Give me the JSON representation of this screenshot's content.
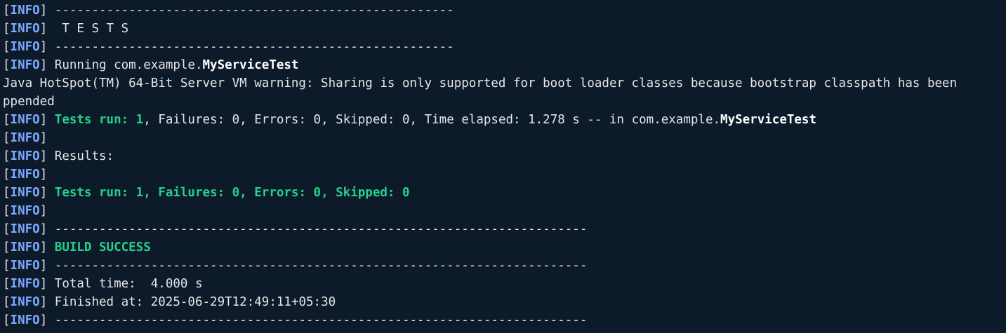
{
  "terminal": {
    "background": "#0c1a2a",
    "foreground": "#e6e6e6",
    "info_color": "#7aa7ff",
    "success_color": "#23d18b",
    "info_tag": "INFO",
    "lines": [
      {
        "segments": [
          {
            "style": "plain",
            "text": "------------------------------------------------------"
          }
        ]
      },
      {
        "segments": [
          {
            "style": "plain",
            "text": " T E S T S"
          }
        ]
      },
      {
        "segments": [
          {
            "style": "plain",
            "text": "------------------------------------------------------"
          }
        ]
      },
      {
        "segments": [
          {
            "style": "plain",
            "text": "Running com.example."
          },
          {
            "style": "bold",
            "text": "MyServiceTest"
          }
        ]
      },
      {
        "raw": true,
        "segments": [
          {
            "style": "plain",
            "text": "Java HotSpot(TM) 64-Bit Server VM warning: Sharing is only supported for boot loader classes because bootstrap classpath has been"
          }
        ]
      },
      {
        "raw": true,
        "segments": [
          {
            "style": "plain",
            "text": "ppended"
          }
        ]
      },
      {
        "segments": [
          {
            "style": "green",
            "text": "Tests run: 1"
          },
          {
            "style": "plain",
            "text": ", Failures: 0, Errors: 0, Skipped: 0, Time elapsed: 1.278 s -- in com.example."
          },
          {
            "style": "bold",
            "text": "MyServiceTest"
          }
        ]
      },
      {
        "segments": []
      },
      {
        "segments": [
          {
            "style": "plain",
            "text": "Results:"
          }
        ]
      },
      {
        "segments": []
      },
      {
        "segments": [
          {
            "style": "green",
            "text": "Tests run: 1, Failures: 0, Errors: 0, Skipped: 0"
          }
        ]
      },
      {
        "segments": []
      },
      {
        "segments": [
          {
            "style": "plain",
            "text": "------------------------------------------------------------------------"
          }
        ]
      },
      {
        "segments": [
          {
            "style": "green",
            "text": "BUILD SUCCESS"
          }
        ]
      },
      {
        "segments": [
          {
            "style": "plain",
            "text": "------------------------------------------------------------------------"
          }
        ]
      },
      {
        "segments": [
          {
            "style": "plain",
            "text": "Total time:  4.000 s"
          }
        ]
      },
      {
        "segments": [
          {
            "style": "plain",
            "text": "Finished at: 2025-06-29T12:49:11+05:30"
          }
        ]
      },
      {
        "segments": [
          {
            "style": "plain",
            "text": "------------------------------------------------------------------------"
          }
        ]
      }
    ]
  }
}
